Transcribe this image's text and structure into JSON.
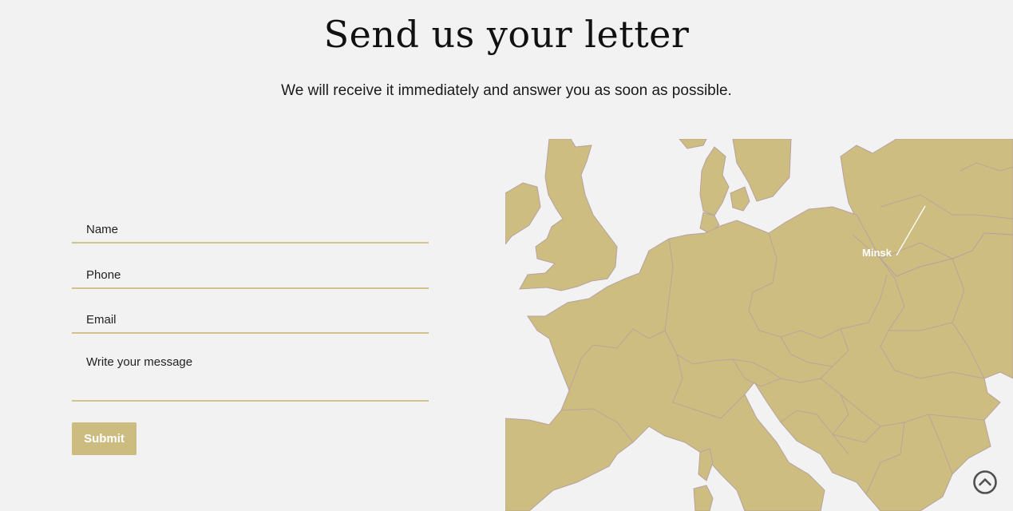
{
  "header": {
    "title": "Send us your letter",
    "subtitle": "We will receive it immediately and answer you as soon as possible."
  },
  "form": {
    "name_placeholder": "Name",
    "phone_placeholder": "Phone",
    "email_placeholder": "Email",
    "message_placeholder": "Write your message",
    "submit_label": "Submit"
  },
  "map": {
    "marker_label": "Minsk",
    "land_color": "#cdbd80",
    "border_color": "#b7a2a0",
    "sea_color": "#f3f2f2"
  },
  "scroll_top": {
    "icon": "chevron-up-circle-icon"
  }
}
